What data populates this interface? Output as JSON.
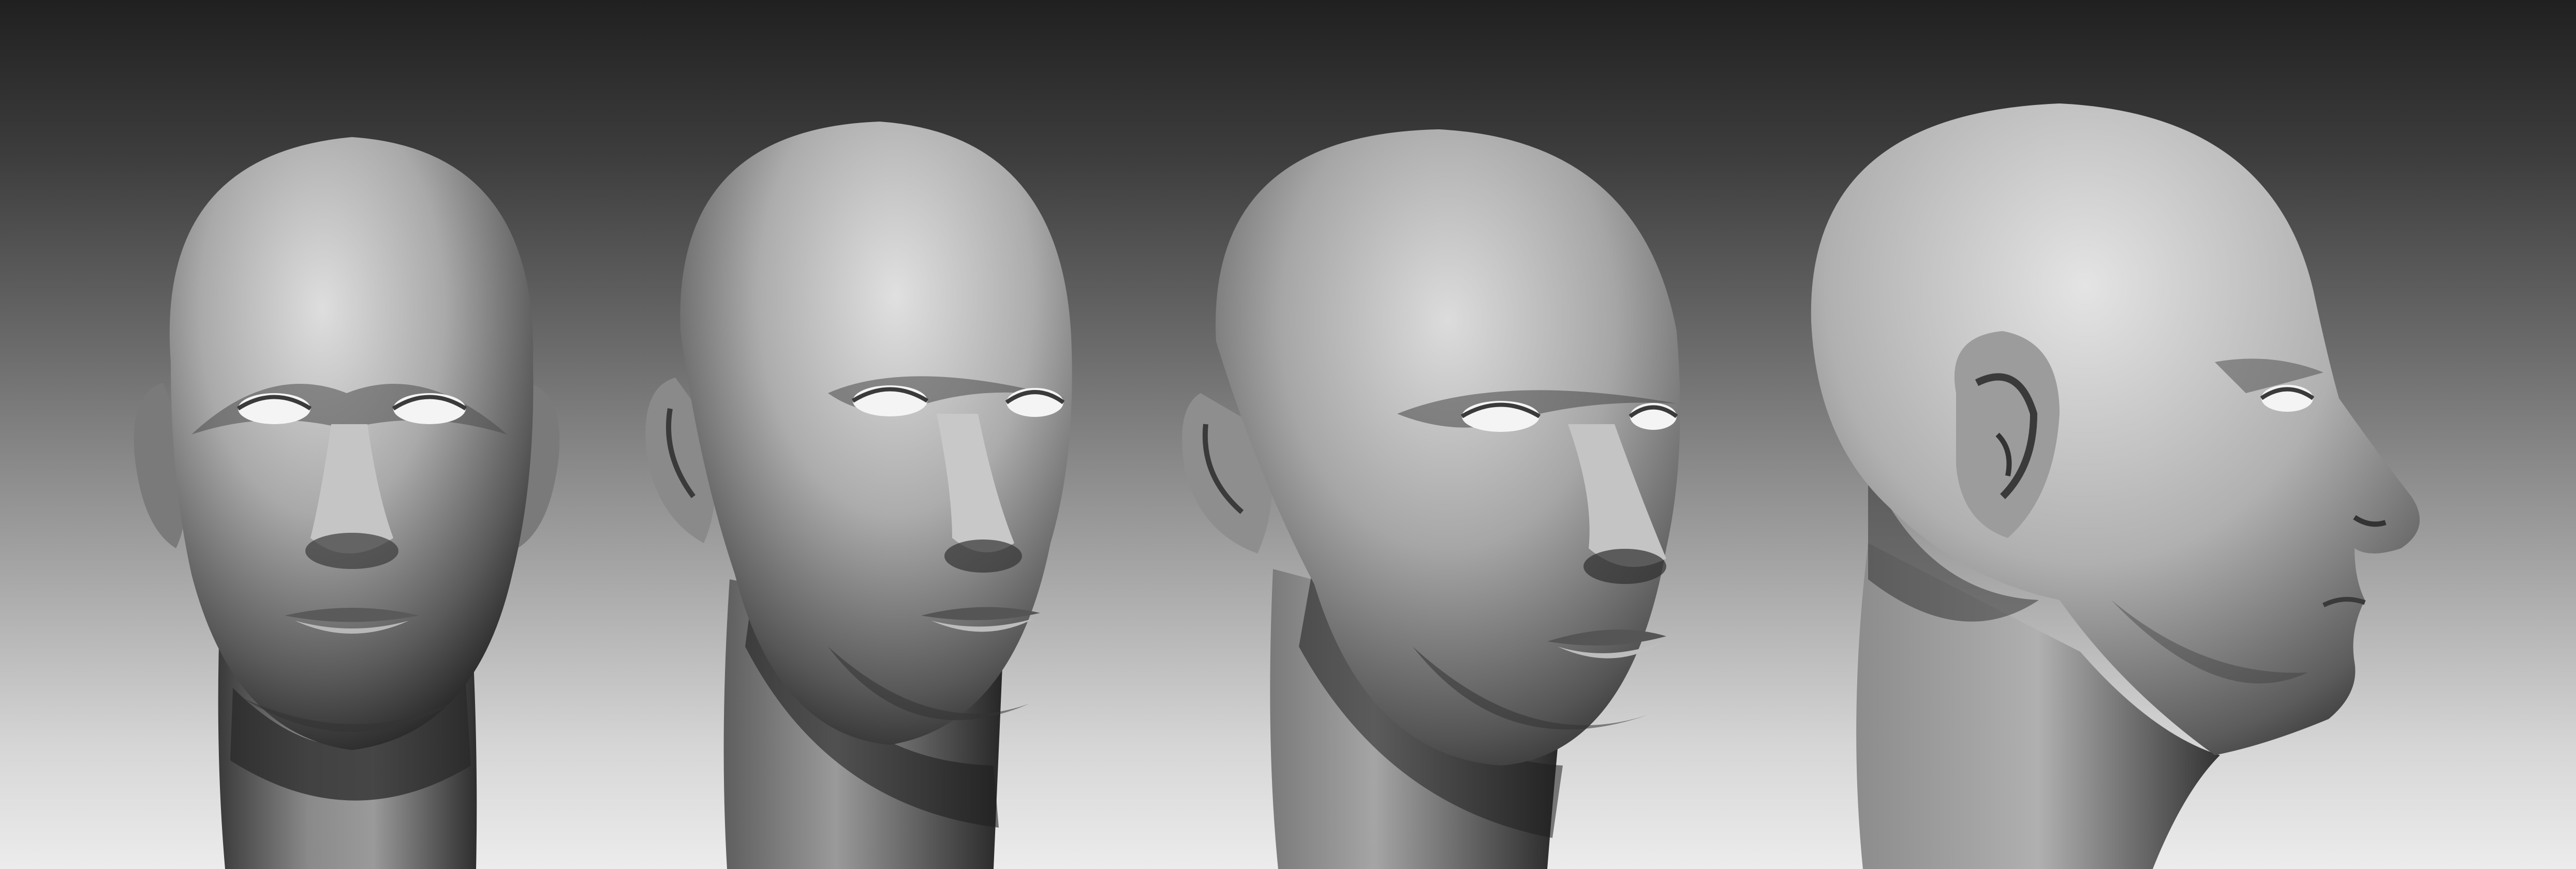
{
  "scene": {
    "description_free": true,
    "background": {
      "top_color": "#202020",
      "bottom_color": "#ececec"
    },
    "material": {
      "clay_light": "#e2e2e2",
      "clay_mid": "#9a9a9a",
      "clay_dark": "#2a2a2a",
      "eye_white": "#f4f4f4"
    },
    "views": [
      {
        "id": "front",
        "icon": "head-front-view"
      },
      {
        "id": "three-quarter-slight",
        "icon": "head-quarter-view"
      },
      {
        "id": "three-quarter",
        "icon": "head-three-quarter-view"
      },
      {
        "id": "profile",
        "icon": "head-profile-view"
      }
    ]
  }
}
